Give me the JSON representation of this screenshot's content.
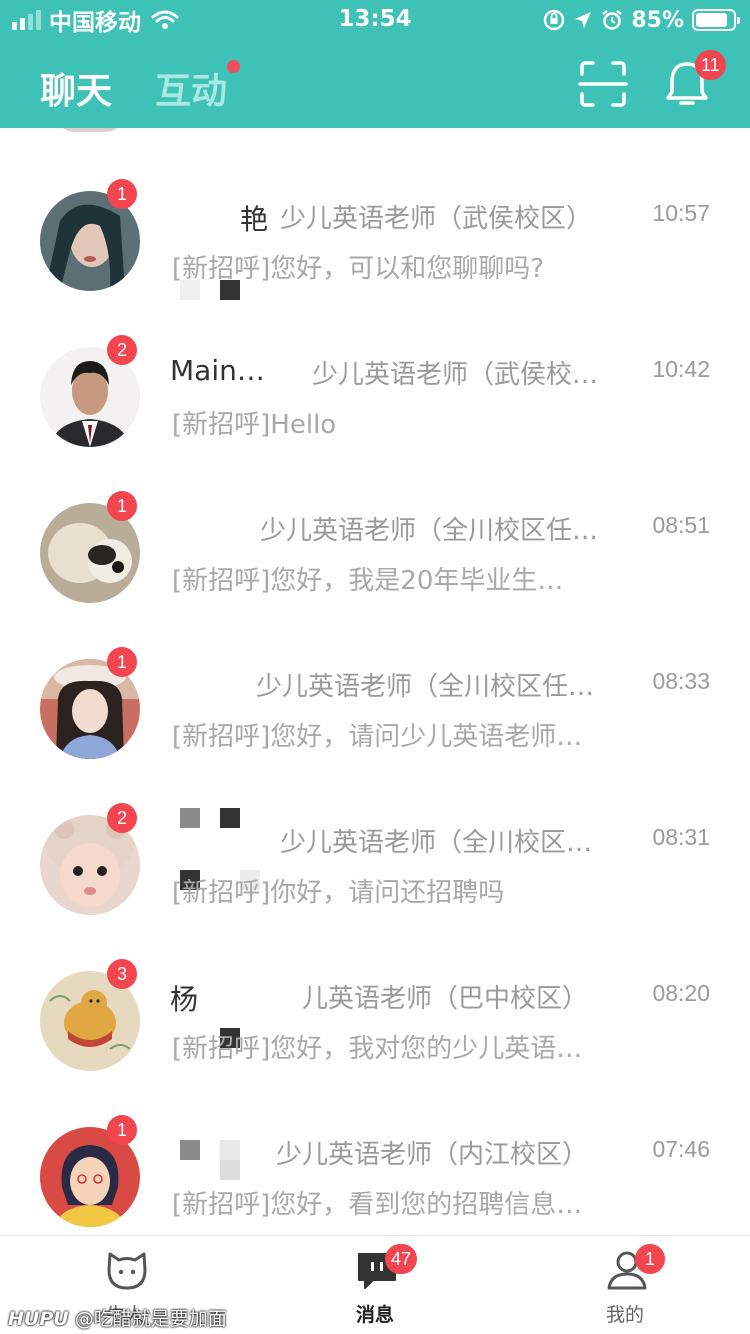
{
  "status_bar": {
    "carrier": "中国移动",
    "time": "13:54",
    "battery": "85%",
    "battery_level": 0.85
  },
  "header": {
    "tab_chat": "聊天",
    "tab_interact": "互动",
    "notification_count": "11",
    "accent_color": "#3ec1b6"
  },
  "conversations": [
    {
      "name": "艳",
      "job": "少儿英语老师（武侯校区）",
      "time": "10:57",
      "tag": "[新招呼]",
      "message": "您好，可以和您聊聊吗?",
      "unread": "1"
    },
    {
      "name": "Main…",
      "job": "少儿英语老师（武侯校…",
      "time": "10:42",
      "tag": "[新招呼]",
      "message": "Hello",
      "unread": "2"
    },
    {
      "name": "",
      "job": "少儿英语老师（全川校区任…",
      "time": "08:51",
      "tag": "[新招呼]",
      "message": "您好，我是20年毕业生…",
      "unread": "1"
    },
    {
      "name": "",
      "job": "少儿英语老师（全川校区任…",
      "time": "08:33",
      "tag": "[新招呼]",
      "message": "您好，请问少儿英语老师…",
      "unread": "1"
    },
    {
      "name": "",
      "job": "少儿英语老师（全川校区…",
      "time": "08:31",
      "tag": "[新招呼]",
      "message": "你好，请问还招聘吗",
      "unread": "2"
    },
    {
      "name": "杨",
      "job": "儿英语老师（巴中校区）",
      "time": "08:20",
      "tag": "[新招呼]",
      "message": "您好，我对您的少儿英语…",
      "unread": "3"
    },
    {
      "name": "",
      "job": "少儿英语老师（内江校区）",
      "time": "07:46",
      "tag": "[新招呼]",
      "message": "您好，看到您的招聘信息…",
      "unread": "1"
    }
  ],
  "tabbar": {
    "items": [
      {
        "label": "牛人",
        "badge": ""
      },
      {
        "label": "消息",
        "badge": "47"
      },
      {
        "label": "我的",
        "badge": "1"
      }
    ]
  },
  "watermark": {
    "brand": "HUPU",
    "text": "@吃醋就是要加面"
  },
  "colors": {
    "badge": "#f2454f",
    "name": "#333333",
    "secondary": "#9a9a9a"
  },
  "icons": {
    "scan": "scan-icon",
    "bell": "bell-icon",
    "home": "cat-face-icon",
    "messages": "chat-bubble-icon",
    "profile": "person-icon"
  }
}
